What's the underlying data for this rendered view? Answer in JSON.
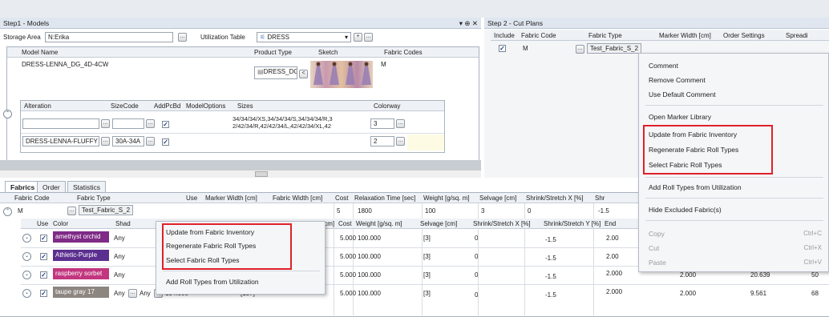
{
  "top_strip_color": "#e8ecf1",
  "step1": {
    "title": "Step1 - Models",
    "pin_close": "▾ ⊕ ✕",
    "storage_label": "Storage Area",
    "storage_value": "N:Erika",
    "utilization_label": "Utilization Table",
    "utilization_value": "DRESS",
    "model_headers": [
      "Model Name",
      "Product Type",
      "Sketch",
      "Fabric Codes"
    ],
    "model_name": "DRESS-LENNA_DG_4D-4CW",
    "product_type": "DRESS_DG",
    "fabric_codes": "M",
    "alt_headers": [
      "Alteration",
      "SizeCode",
      "AddPcBd",
      "ModelOptions",
      "Sizes",
      "Colorway"
    ],
    "alt_rows": [
      {
        "alteration": "",
        "sizecode": "",
        "sizes": "34/34/34/XS,34/34/34/S,34/34/34/R,3\n2/42/34/R,42/42/34/L,42/42/34/XL,42",
        "colorway": "3"
      },
      {
        "alteration": "DRESS-LENNA-FLUFFY",
        "sizecode": "30A-34A",
        "sizes": "",
        "colorway": "2"
      }
    ]
  },
  "step2": {
    "title": "Step 2 - Cut Plans",
    "headers": [
      "Include",
      "Fabric Code",
      "Fabric Type",
      "Marker Width [cm]",
      "Order Settings",
      "Spreadi"
    ],
    "row": {
      "fabric_code": "M",
      "fabric_type": "Test_Fabric_S_2"
    }
  },
  "context_menu_right": {
    "items": [
      "Comment",
      "Remove Comment",
      "Use Default Comment",
      "Open Marker Library",
      "Update from Fabric Inventory",
      "Regenerate Fabric Roll Types",
      "Select Fabric Roll Types",
      "Add Roll Types from Utilization",
      "Hide Excluded Fabric(s)",
      "Copy",
      "Cut",
      "Paste"
    ],
    "shortcuts": {
      "copy": "Ctrl+C",
      "cut": "Ctrl+X",
      "paste": "Ctrl+V"
    }
  },
  "tabs": [
    "Fabrics",
    "Order",
    "Statistics"
  ],
  "fabrics": {
    "headers": [
      "Fabric Code",
      "Fabric Type",
      "Use",
      "Marker Width [cm]",
      "Fabric Width [cm]",
      "Cost",
      "Relaxation Time [sec]",
      "Weight [g/sq. m]",
      "Selvage [cm]",
      "Shrink/Stretch X [%]",
      "Shr"
    ],
    "row": {
      "code": "M",
      "type": "Test_Fabric_S_2",
      "cost": "5",
      "relax": "1800",
      "weight": "100",
      "selvage": "3",
      "shrink_x": "0",
      "shr": "-1.5"
    },
    "color_headers": [
      "Use",
      "Color",
      "Shad",
      "[cm]",
      "Cost",
      "Weight [g/sq. m]",
      "Selvage [cm]",
      "Shrink/Stretch X [%]",
      "Shrink/Stretch Y [%]",
      "End"
    ],
    "colors": [
      {
        "name": "amethyst orchid",
        "shade": "Any",
        "cost": "5.000",
        "weight": "100.000",
        "selvage": "[3]",
        "shx": "0",
        "shy": "-1.5",
        "end": "2.00",
        "swatch": "#7e2a86"
      },
      {
        "name": "Athletic-Purple",
        "shade": "Any",
        "cost": "5.000",
        "weight": "100.000",
        "selvage": "[3]",
        "shx": "0",
        "shy": "-1.5",
        "end": "2.00",
        "swatch": "#5b2f8f"
      },
      {
        "name": "raspberry sorbet",
        "shade": "Any",
        "cost": "5.000",
        "weight": "100.000",
        "selvage": "[3]",
        "shx": "0",
        "shy": "-1.5",
        "end": "2.000",
        "c2": "2.000",
        "c3": "20.639",
        "c4": "50",
        "swatch": "#c2367f"
      },
      {
        "name": "taupe gray 17",
        "shade": "Any",
        "shade2": "Any",
        "width": "134.000",
        "w2": "[137]",
        "cost": "5.000",
        "weight": "100.000",
        "selvage": "[3]",
        "shx": "0",
        "shy": "-1.5",
        "end": "2.000",
        "c2": "2.000",
        "c3": "9.561",
        "c4": "68",
        "swatch": "#8d8580"
      }
    ]
  },
  "context_menu_left": {
    "items": [
      "Update from Fabric Inventory",
      "Regenerate Fabric Roll Types",
      "Select Fabric Roll Types",
      "Add Roll Types from Utilization"
    ]
  }
}
